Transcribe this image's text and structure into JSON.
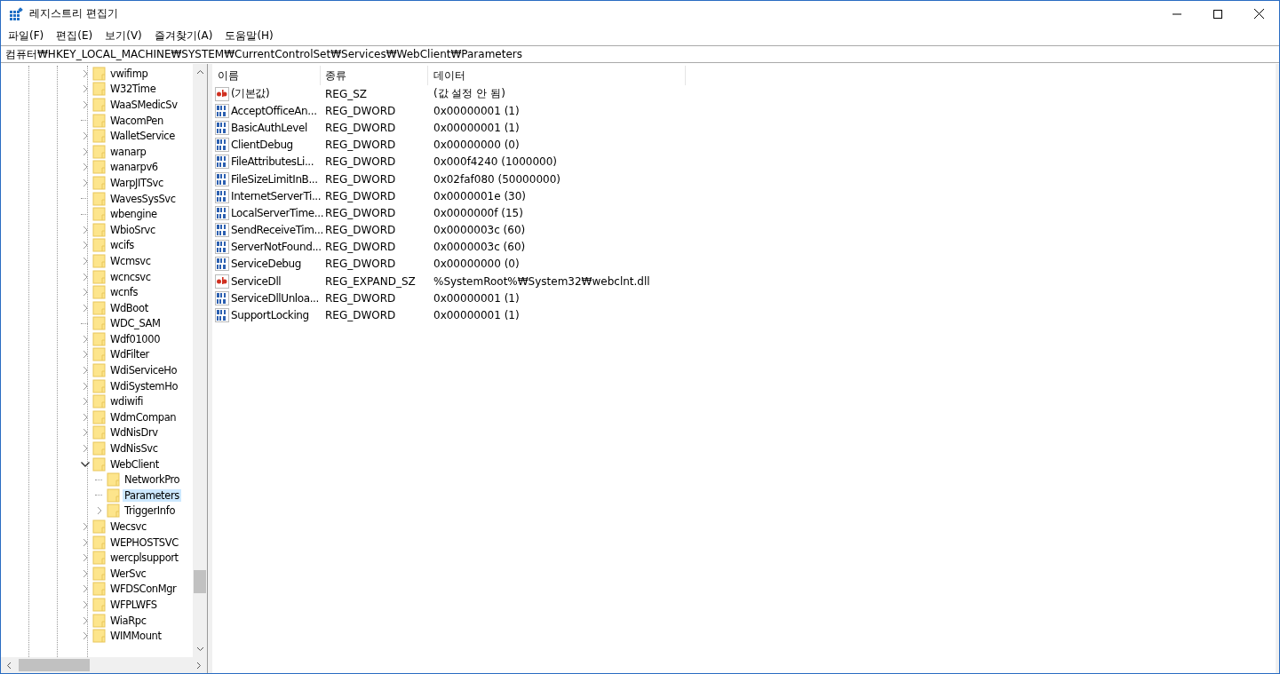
{
  "window": {
    "title": "레지스트리 편집기"
  },
  "menu": [
    "파일(F)",
    "편집(E)",
    "보기(V)",
    "즐겨찾기(A)",
    "도움말(H)"
  ],
  "address": "컴퓨터₩HKEY_LOCAL_MACHINE₩SYSTEM₩CurrentControlSet₩Services₩WebClient₩Parameters",
  "tree": [
    {
      "label": "vwifimp",
      "expandable": true,
      "expanded": false,
      "selected": false
    },
    {
      "label": "W32Time",
      "expandable": true,
      "expanded": false,
      "selected": false
    },
    {
      "label": "WaaSMedicSv",
      "expandable": true,
      "expanded": false,
      "selected": false
    },
    {
      "label": "WacomPen",
      "expandable": false,
      "expanded": false,
      "selected": false
    },
    {
      "label": "WalletService",
      "expandable": true,
      "expanded": false,
      "selected": false
    },
    {
      "label": "wanarp",
      "expandable": true,
      "expanded": false,
      "selected": false
    },
    {
      "label": "wanarpv6",
      "expandable": true,
      "expanded": false,
      "selected": false
    },
    {
      "label": "WarpJITSvc",
      "expandable": true,
      "expanded": false,
      "selected": false
    },
    {
      "label": "WavesSysSvc",
      "expandable": false,
      "expanded": false,
      "selected": false
    },
    {
      "label": "wbengine",
      "expandable": false,
      "expanded": false,
      "selected": false
    },
    {
      "label": "WbioSrvc",
      "expandable": true,
      "expanded": false,
      "selected": false
    },
    {
      "label": "wcifs",
      "expandable": true,
      "expanded": false,
      "selected": false
    },
    {
      "label": "Wcmsvc",
      "expandable": true,
      "expanded": false,
      "selected": false
    },
    {
      "label": "wcncsvc",
      "expandable": true,
      "expanded": false,
      "selected": false
    },
    {
      "label": "wcnfs",
      "expandable": true,
      "expanded": false,
      "selected": false
    },
    {
      "label": "WdBoot",
      "expandable": true,
      "expanded": false,
      "selected": false
    },
    {
      "label": "WDC_SAM",
      "expandable": false,
      "expanded": false,
      "selected": false
    },
    {
      "label": "Wdf01000",
      "expandable": true,
      "expanded": false,
      "selected": false
    },
    {
      "label": "WdFilter",
      "expandable": true,
      "expanded": false,
      "selected": false
    },
    {
      "label": "WdiServiceHo",
      "expandable": true,
      "expanded": false,
      "selected": false
    },
    {
      "label": "WdiSystemHo",
      "expandable": true,
      "expanded": false,
      "selected": false
    },
    {
      "label": "wdiwifi",
      "expandable": true,
      "expanded": false,
      "selected": false
    },
    {
      "label": "WdmCompan",
      "expandable": true,
      "expanded": false,
      "selected": false
    },
    {
      "label": "WdNisDrv",
      "expandable": true,
      "expanded": false,
      "selected": false
    },
    {
      "label": "WdNisSvc",
      "expandable": true,
      "expanded": false,
      "selected": false
    },
    {
      "label": "WebClient",
      "expandable": true,
      "expanded": true,
      "selected": false,
      "children": [
        {
          "label": "NetworkPro",
          "expandable": false,
          "expanded": false,
          "selected": false
        },
        {
          "label": "Parameters",
          "expandable": false,
          "expanded": false,
          "selected": true
        },
        {
          "label": "TriggerInfo",
          "expandable": true,
          "expanded": false,
          "selected": false
        }
      ]
    },
    {
      "label": "Wecsvc",
      "expandable": true,
      "expanded": false,
      "selected": false
    },
    {
      "label": "WEPHOSTSVC",
      "expandable": true,
      "expanded": false,
      "selected": false
    },
    {
      "label": "wercplsupport",
      "expandable": true,
      "expanded": false,
      "selected": false
    },
    {
      "label": "WerSvc",
      "expandable": true,
      "expanded": false,
      "selected": false
    },
    {
      "label": "WFDSConMgr",
      "expandable": true,
      "expanded": false,
      "selected": false
    },
    {
      "label": "WFPLWFS",
      "expandable": true,
      "expanded": false,
      "selected": false
    },
    {
      "label": "WiaRpc",
      "expandable": true,
      "expanded": false,
      "selected": false
    },
    {
      "label": "WIMMount",
      "expandable": true,
      "expanded": false,
      "selected": false
    }
  ],
  "table": {
    "columns": [
      "이름",
      "종류",
      "데이터"
    ],
    "rows": [
      {
        "kind": "string",
        "name": "(기본값)",
        "type": "REG_SZ",
        "data": "(값 설정 안 됨)"
      },
      {
        "kind": "binary",
        "name": "AcceptOfficeAn...",
        "type": "REG_DWORD",
        "data": "0x00000001 (1)"
      },
      {
        "kind": "binary",
        "name": "BasicAuthLevel",
        "type": "REG_DWORD",
        "data": "0x00000001 (1)"
      },
      {
        "kind": "binary",
        "name": "ClientDebug",
        "type": "REG_DWORD",
        "data": "0x00000000 (0)"
      },
      {
        "kind": "binary",
        "name": "FileAttributesLi...",
        "type": "REG_DWORD",
        "data": "0x000f4240 (1000000)"
      },
      {
        "kind": "binary",
        "name": "FileSizeLimitInB...",
        "type": "REG_DWORD",
        "data": "0x02faf080 (50000000)"
      },
      {
        "kind": "binary",
        "name": "InternetServerTi...",
        "type": "REG_DWORD",
        "data": "0x0000001e (30)"
      },
      {
        "kind": "binary",
        "name": "LocalServerTime...",
        "type": "REG_DWORD",
        "data": "0x0000000f (15)"
      },
      {
        "kind": "binary",
        "name": "SendReceiveTim...",
        "type": "REG_DWORD",
        "data": "0x0000003c (60)"
      },
      {
        "kind": "binary",
        "name": "ServerNotFound...",
        "type": "REG_DWORD",
        "data": "0x0000003c (60)"
      },
      {
        "kind": "binary",
        "name": "ServiceDebug",
        "type": "REG_DWORD",
        "data": "0x00000000 (0)"
      },
      {
        "kind": "string",
        "name": "ServiceDll",
        "type": "REG_EXPAND_SZ",
        "data": "%SystemRoot%₩System32₩webclnt.dll"
      },
      {
        "kind": "binary",
        "name": "ServiceDllUnloa...",
        "type": "REG_DWORD",
        "data": "0x00000001 (1)"
      },
      {
        "kind": "binary",
        "name": "SupportLocking",
        "type": "REG_DWORD",
        "data": "0x00000001 (1)"
      }
    ]
  }
}
